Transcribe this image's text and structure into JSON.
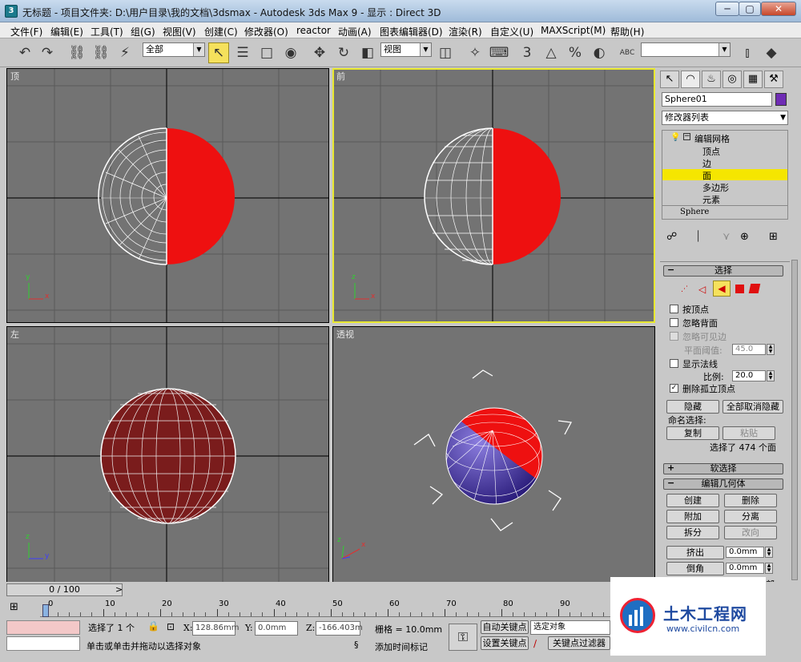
{
  "window": {
    "title": "无标题 - 项目文件夹: D:\\用户目录\\我的文档\\3dsmax - Autodesk 3ds Max 9 - 显示 : Direct 3D",
    "btn_min": "─",
    "btn_max": "▢",
    "btn_close": "✕"
  },
  "menu": [
    "文件(F)",
    "编辑(E)",
    "工具(T)",
    "组(G)",
    "视图(V)",
    "创建(C)",
    "修改器(O)",
    "reactor",
    "动画(A)",
    "图表编辑器(D)",
    "渲染(R)",
    "自定义(U)",
    "MAXScript(M)",
    "帮助(H)"
  ],
  "toolbar": {
    "selection_filter": "全部",
    "coord_system": "视图",
    "dropdown_arrow": "▼",
    "named_sel": ""
  },
  "icons": {
    "undo": "↶",
    "redo": "↷",
    "select-link": "⛓",
    "unlink": "⛓",
    "bind": "⚡",
    "select": "↖",
    "select-name": "☰",
    "rect-region": "□",
    "window": "◉",
    "move": "✥",
    "rotate": "↻",
    "scale": "◧",
    "pivot": "◫",
    "manipulate": "✧",
    "keyboard": "⌨",
    "snap": "3",
    "angle-snap": "△",
    "percent-snap": "%",
    "spinner-snap": "◐",
    "named": "ABC",
    "mirror": "⫾",
    "align": "◆",
    "t1": "↖",
    "t2": "◠",
    "t3": "♨",
    "t4": "◎",
    "t5": "▦",
    "t6": "⚒",
    "a": "☍",
    "b": "⏐",
    "c": "⋎",
    "d": "⊕",
    "e": "⊞"
  },
  "viewports": {
    "top": "顶",
    "front": "前",
    "left": "左",
    "persp": "透视"
  },
  "axes": {
    "x": "x",
    "y": "y",
    "z": "z"
  },
  "panel": {
    "object_name": "Sphere01",
    "object_color": "#6f2cb4",
    "modifier_list": "修改器列表",
    "modifier_arrow": "▼",
    "stack": {
      "root": "编辑网格",
      "items": [
        "顶点",
        "边",
        "面",
        "多边形",
        "元素"
      ],
      "selected": "面",
      "base": "Sphere"
    },
    "rollout_selection": "选择",
    "rollout_soft": "软选择",
    "rollout_edit": "编辑几何体",
    "minus": "−",
    "plus": "+",
    "by_vertex": "按顶点",
    "ignore_back": "忽略背面",
    "ignore_visible": "忽略可见边",
    "planar_thresh": "平面阈值:",
    "planar_val": "45.0",
    "show_normals": "显示法线",
    "scale": "比例:",
    "scale_val": "20.0",
    "delete_isolated": "删除孤立顶点",
    "check": "✓",
    "hide": "隐藏",
    "unhide_all": "全部取消隐藏",
    "named_sel": "命名选择:",
    "copy": "复制",
    "paste": "粘贴",
    "sel_count": "选择了 474 个面",
    "create": "创建",
    "delete": "删除",
    "attach": "附加",
    "detach": "分离",
    "divide": "拆分",
    "turn": "改向",
    "extrude": "挤出",
    "bevel": "倒角",
    "ex_val": "0.0mm",
    "bv_val": "0.0mm",
    "more": "部"
  },
  "timeline": {
    "frame": "0 / 100",
    "ticks": [
      "0",
      "10",
      "20",
      "30",
      "40",
      "50",
      "60",
      "70",
      "80",
      "90"
    ]
  },
  "status": {
    "selected": "选择了 1 个",
    "x_label": "X:",
    "x_val": "128.86mm",
    "y_label": "Y:",
    "y_val": "0.0mm",
    "z_label": "Z:",
    "z_val": "-166.403m",
    "grid": "栅格 = 10.0mm",
    "prompt": "单击或单击并拖动以选择对象",
    "add_tag": "添加时间标记",
    "auto_key": "自动关键点",
    "set_key": "设置关键点",
    "selected_obj": "选定对象",
    "key_filters": "关键点过滤器"
  },
  "watermark": {
    "brand": "土木工程网",
    "url": "www.civilcn.com"
  }
}
